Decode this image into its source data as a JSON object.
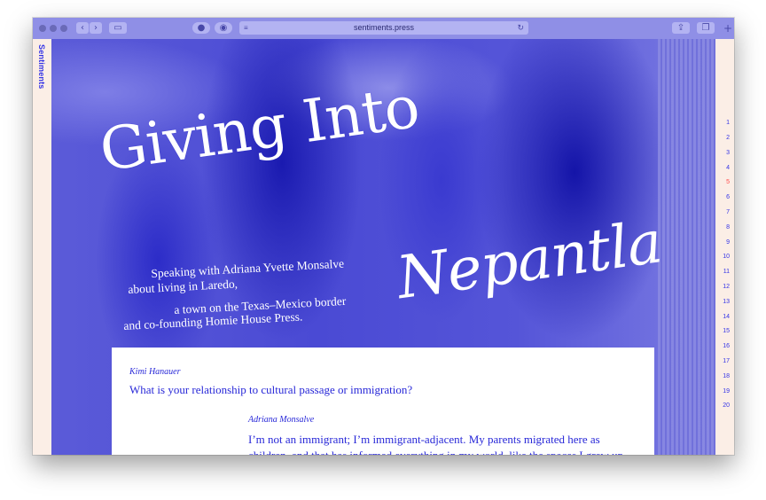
{
  "browser": {
    "url": "sentiments.press"
  },
  "site": {
    "brand": "Sentiments"
  },
  "article": {
    "title_line1": "Giving Into",
    "title_line2": "Nepantla",
    "subtitle_lines": [
      "Speaking with Adriana Yvette Monsalve",
      "about living in Laredo,",
      "a town on the Texas–Mexico border",
      "and co-founding Homie House Press."
    ],
    "interviewer": "Kimi Hanauer",
    "question": "What is your relationship to cultural passage or immigration?",
    "respondent": "Adriana Monsalve",
    "answer": "I’m not an immigrant; I’m immigrant-adjacent. My parents migrated here as children, and that has informed everything in my world, like the spaces I grew up"
  },
  "sections": {
    "numbers": [
      "1",
      "2",
      "3",
      "4",
      "5",
      "6",
      "7",
      "8",
      "9",
      "10",
      "11",
      "12",
      "13",
      "14",
      "15",
      "16",
      "17",
      "18",
      "19",
      "20"
    ],
    "active": "5"
  },
  "colors": {
    "accent": "#3434e6",
    "active": "#ff4a4a",
    "background": "#fbeee6"
  }
}
